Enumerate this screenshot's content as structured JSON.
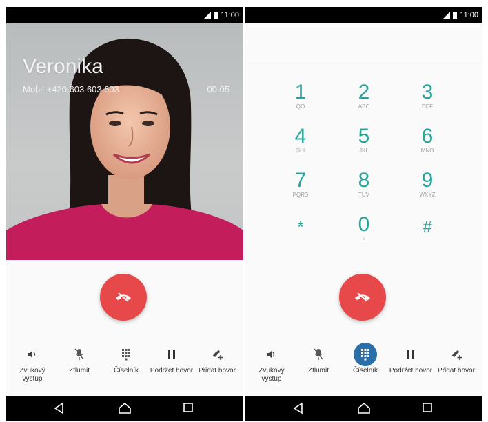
{
  "status": {
    "time": "11:00"
  },
  "call": {
    "name": "Veronika",
    "number_line": "Mobil +420 603 603 603",
    "timer": "00:05"
  },
  "dialpad": {
    "keys": [
      {
        "num": "1",
        "letters": "QO"
      },
      {
        "num": "2",
        "letters": "ABC"
      },
      {
        "num": "3",
        "letters": "DEF"
      },
      {
        "num": "4",
        "letters": "GHI"
      },
      {
        "num": "5",
        "letters": "JKL"
      },
      {
        "num": "6",
        "letters": "MNO"
      },
      {
        "num": "7",
        "letters": "PQRS"
      },
      {
        "num": "8",
        "letters": "TUV"
      },
      {
        "num": "9",
        "letters": "WXYZ"
      },
      {
        "num": "*",
        "letters": ""
      },
      {
        "num": "0",
        "letters": "+"
      },
      {
        "num": "#",
        "letters": ""
      }
    ]
  },
  "controls": {
    "speaker": "Zvukový výstup",
    "mute": "Ztlumit",
    "keypad": "Číselník",
    "hold": "Podržet hovor",
    "add_call": "Přidat hovor"
  },
  "colors": {
    "end_call": "#e7494a",
    "dialpad_digits": "#26a69a",
    "keypad_active": "#2c6fa8"
  }
}
